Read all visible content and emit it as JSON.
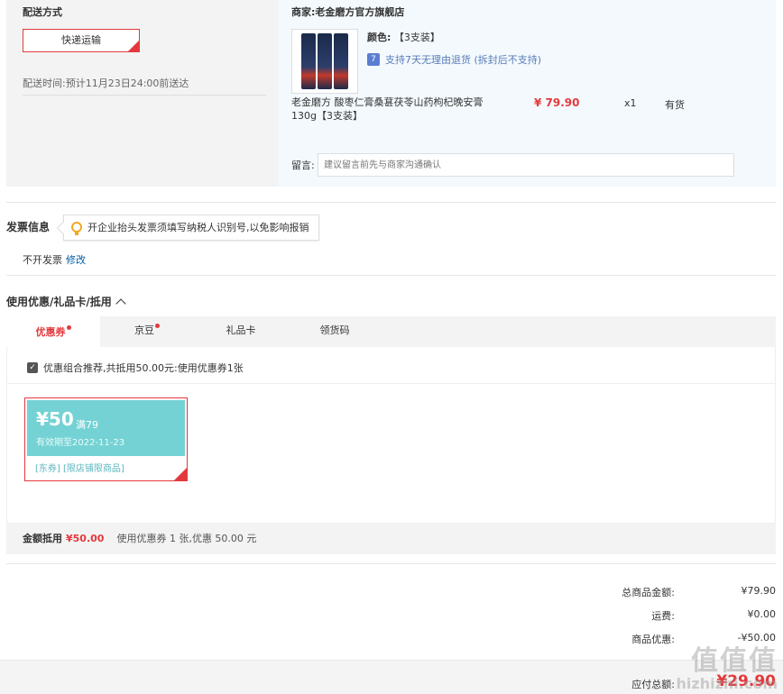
{
  "shipping": {
    "title": "配送方式",
    "method": "快递运输",
    "delivery_time_label": "配送时间:",
    "delivery_time": "预计11月23日24:00前送达"
  },
  "shop": {
    "seller": "商家:老金磨方官方旗舰店",
    "color_label": "颜色:",
    "color_value": "【3支装】",
    "return_policy": "支持7天无理由退货 (拆封后不支持)",
    "product_name": "老金磨方 酸枣仁膏桑葚茯苓山药枸杞晚安膏130g【3支装】",
    "price": "¥ 79.90",
    "quantity": "x1",
    "stock": "有货",
    "message_label": "留言:",
    "message_placeholder": "建议留言前先与商家沟通确认"
  },
  "invoice": {
    "title": "发票信息",
    "tip": "开企业抬头发票须填写纳税人识别号,以免影响报销",
    "value": "不开发票",
    "edit": "修改"
  },
  "coupons": {
    "title": "使用优惠/礼品卡/抵用",
    "tabs": [
      "优惠券",
      "京豆",
      "礼品卡",
      "领货码"
    ],
    "combo_text": "优惠组合推荐,共抵用50.00元:使用优惠券1张",
    "coupon": {
      "amount": "¥50",
      "condition": "满79",
      "expiry": "有效期至2022-11-23",
      "tags": "[东券] [限店铺限商品]"
    },
    "footer_label": "金额抵用",
    "footer_amount": "¥50.00",
    "footer_desc": "使用优惠券 1 张,优惠 50.00 元"
  },
  "totals": {
    "goods_label": "总商品金额:",
    "goods_value": "¥79.90",
    "freight_label": "运费:",
    "freight_value": "¥0.00",
    "discount_label": "商品优惠:",
    "discount_value": "-¥50.00",
    "payable_label": "应付总额:",
    "payable_value": "¥29.90"
  },
  "watermark": {
    "glyphs": "值值值",
    "url": "hizhizhi.com"
  },
  "colors": {
    "accent_red": "#e4393c",
    "coupon_teal": "#74d2d4",
    "link_blue": "#005ea7"
  }
}
